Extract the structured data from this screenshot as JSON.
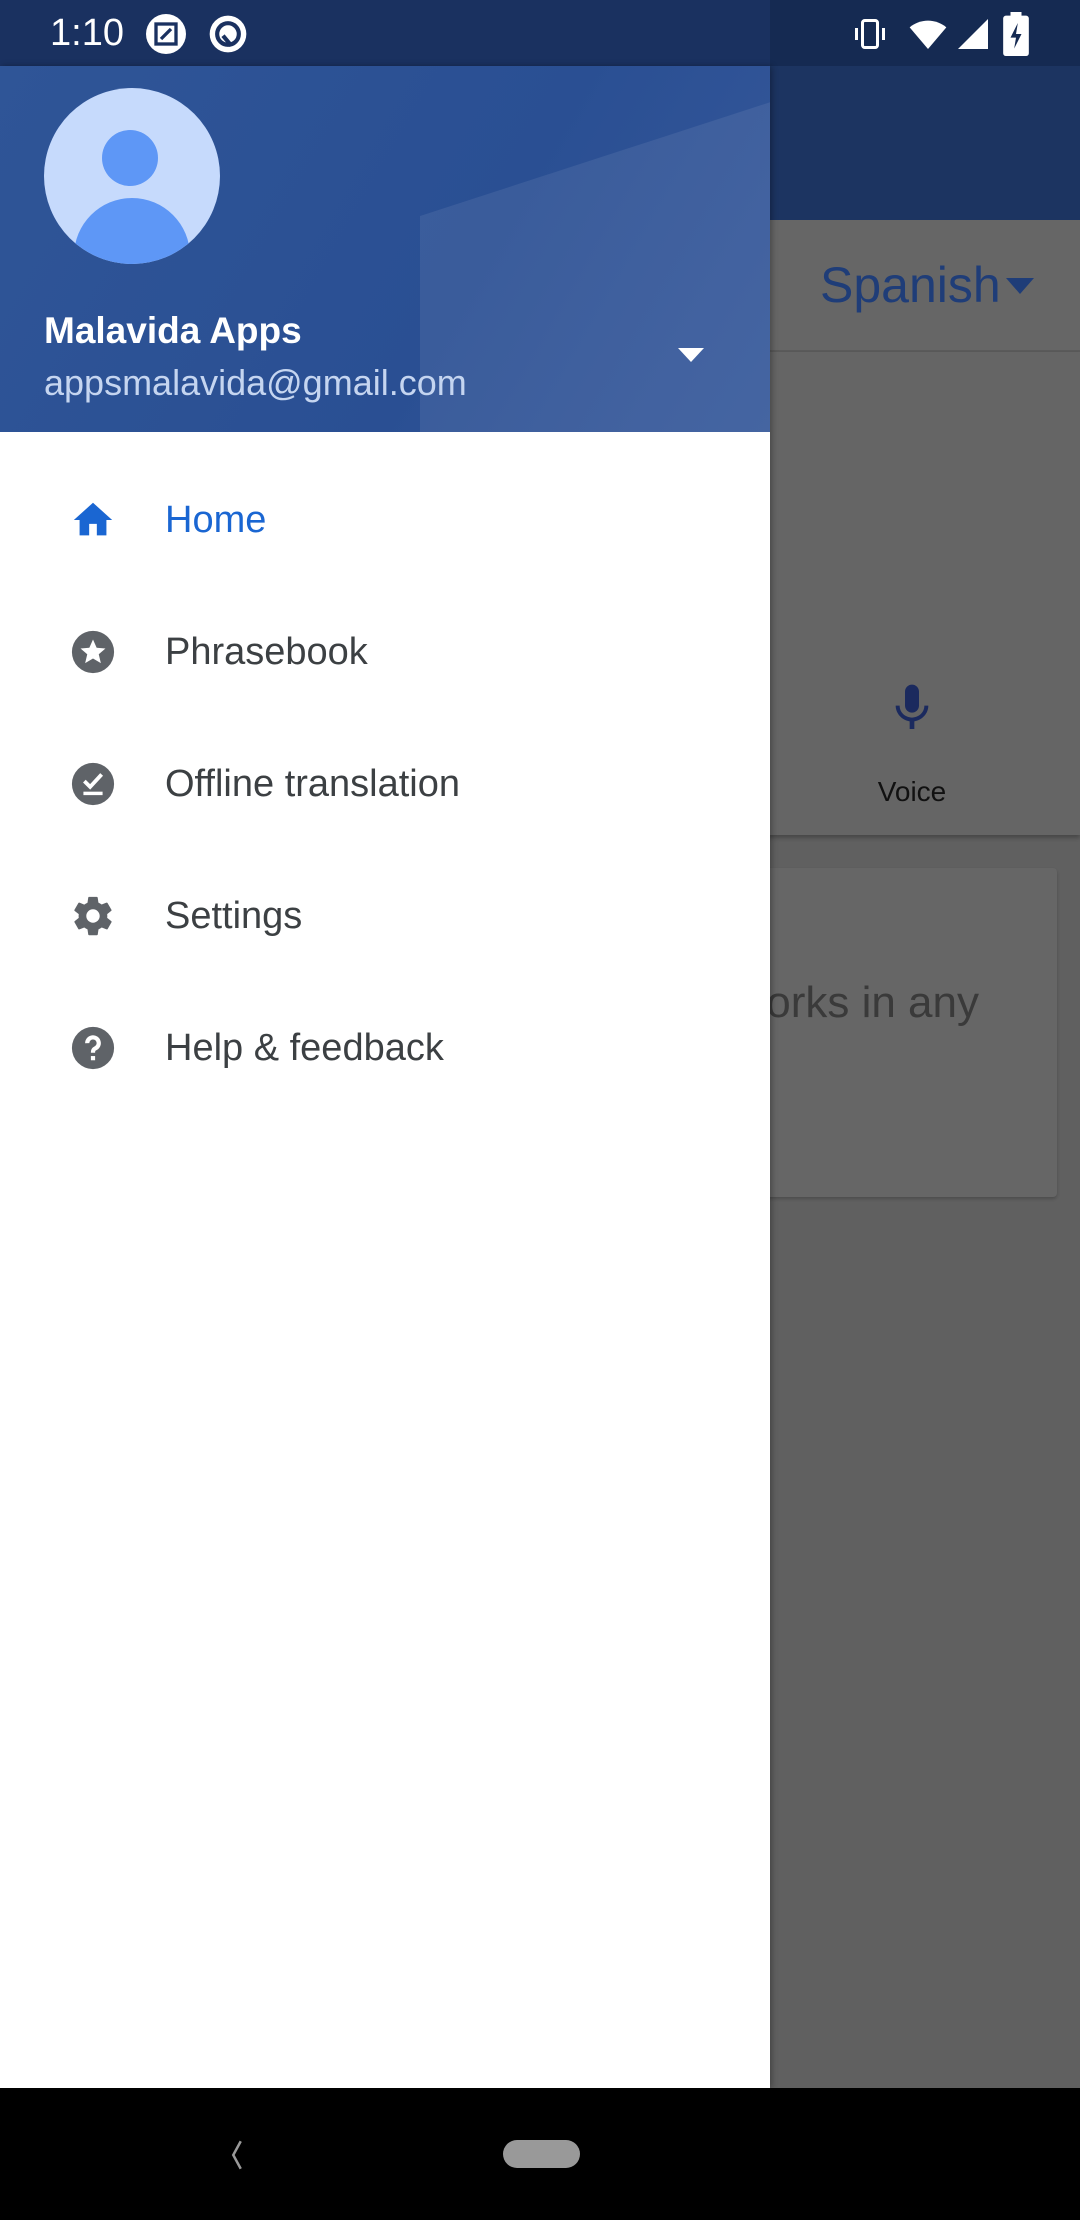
{
  "status_bar": {
    "time": "1:10",
    "left_icons": [
      "screenshot-edit-icon",
      "data-saver-icon"
    ],
    "right_icons": [
      "vibrate-icon",
      "wifi-icon",
      "signal-icon",
      "battery-charging-icon"
    ]
  },
  "background_app": {
    "target_language": "Spanish",
    "voice_label": "Voice",
    "card_text_partial": "works in any"
  },
  "drawer": {
    "account": {
      "name": "Malavida Apps",
      "email": "appsmalavida@gmail.com"
    },
    "items": [
      {
        "label": "Home",
        "icon": "home-icon",
        "active": true
      },
      {
        "label": "Phrasebook",
        "icon": "star-icon",
        "active": false
      },
      {
        "label": "Offline translation",
        "icon": "offline-check-icon",
        "active": false
      },
      {
        "label": "Settings",
        "icon": "gear-icon",
        "active": false
      },
      {
        "label": "Help & feedback",
        "icon": "help-icon",
        "active": false
      }
    ]
  },
  "colors": {
    "accent": "#1a66d2",
    "header": "#2f5597",
    "icon_gray": "#5f6368"
  }
}
